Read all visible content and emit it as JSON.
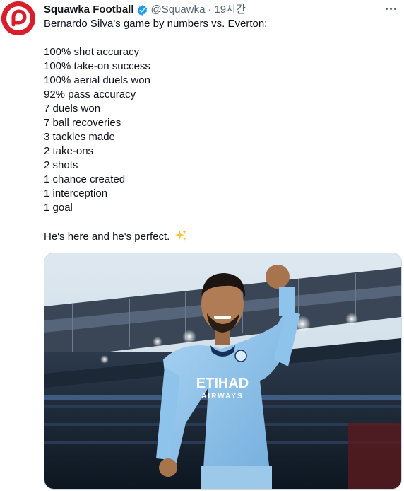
{
  "tweet": {
    "author_name": "Squawka Football",
    "handle": "@Squawka",
    "separator": "·",
    "time": "19시간",
    "intro": "Bernardo Silva's game by numbers vs. Everton:",
    "stats": [
      "100% shot accuracy",
      "100% take-on success",
      "100% aerial duels won",
      "92% pass accuracy",
      "7 duels won",
      "7 ball recoveries",
      "3 tackles made",
      "2 take-ons",
      "2 shots",
      "1 chance created",
      "1 interception",
      "1 goal"
    ],
    "closing": "He's here and he's perfect.",
    "closing_emoji": "sparkles-icon"
  },
  "photo": {
    "shirt_sponsor_line1": "ETIHAD",
    "shirt_sponsor_line2": "AIRWAYS"
  },
  "icons": {
    "avatar": "squawka-logo-icon",
    "verified": "verified-badge-icon",
    "more": "more-options-icon"
  },
  "colors": {
    "brand_red": "#d81e2a",
    "verified_blue": "#1d9bf0",
    "muted_text": "#536471",
    "text": "#0f1419",
    "sky_blue_shirt": "#8ec3ec"
  }
}
